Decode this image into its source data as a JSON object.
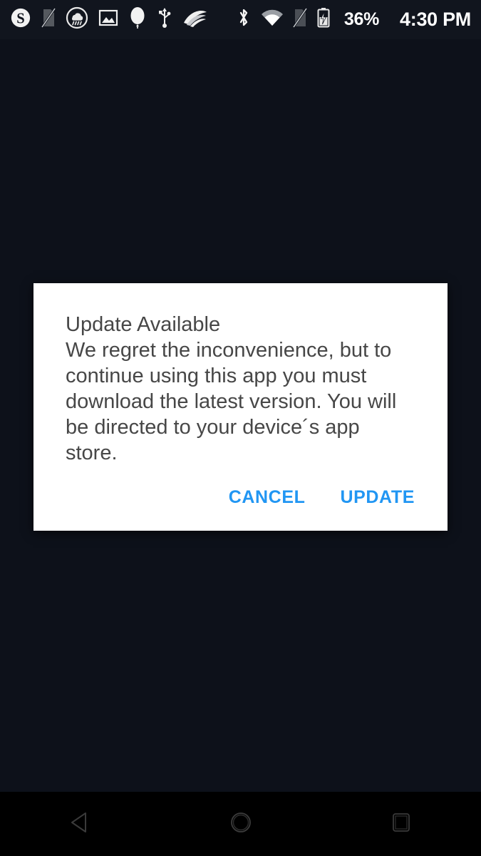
{
  "status_bar": {
    "background_color": "#11151e",
    "left_icons": [
      {
        "name": "skype-icon",
        "label": "Skype"
      },
      {
        "name": "no-sim-icon",
        "label": "No SIM"
      },
      {
        "name": "weather-rain-icon",
        "label": "Rain"
      },
      {
        "name": "gallery-image-icon",
        "label": "Screenshot"
      },
      {
        "name": "balloon-icon",
        "label": "Balloon"
      },
      {
        "name": "usb-icon",
        "label": "USB connected"
      },
      {
        "name": "swiftkey-icon",
        "label": "SwiftKey"
      }
    ],
    "right_icons": [
      {
        "name": "bluetooth-icon",
        "label": "Bluetooth"
      },
      {
        "name": "wifi-icon",
        "label": "Wi-Fi"
      },
      {
        "name": "signal-off-icon",
        "label": "No signal"
      },
      {
        "name": "battery-charging-icon",
        "label": "Battery charging"
      }
    ],
    "battery_percent": "36%",
    "clock": "4:30 PM"
  },
  "dialog": {
    "title": "Update Available",
    "body": "We regret the inconvenience, but to continue using this app you must download the latest version. You will be directed to your device´s app store.",
    "text_color": "#474747",
    "background_color": "#ffffff",
    "accent_color": "#2196f3",
    "buttons": {
      "cancel_label": "CANCEL",
      "update_label": "UPDATE"
    }
  },
  "nav_bar": {
    "background_color": "#000000",
    "buttons": [
      {
        "name": "nav-back-button",
        "label": "Back"
      },
      {
        "name": "nav-home-button",
        "label": "Home"
      },
      {
        "name": "nav-recents-button",
        "label": "Recents"
      }
    ]
  },
  "wallpaper": {
    "background_color": "#0d111a"
  }
}
